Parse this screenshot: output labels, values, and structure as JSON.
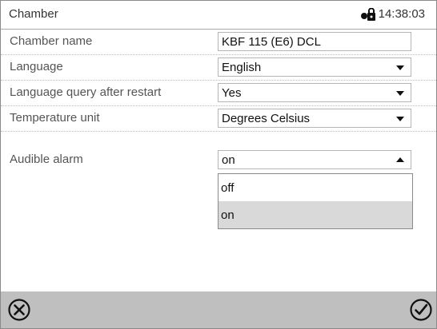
{
  "header": {
    "title": "Chamber",
    "time": "14:38:03",
    "lock_icon": "lock-icon"
  },
  "settings": {
    "chamber_name": {
      "label": "Chamber name",
      "value": "KBF 115 (E6) DCL"
    },
    "language": {
      "label": "Language",
      "value": "English"
    },
    "language_query": {
      "label": "Language query after restart",
      "value": "Yes"
    },
    "temperature_unit": {
      "label": "Temperature unit",
      "value": "Degrees Celsius"
    },
    "audible_alarm": {
      "label": "Audible alarm",
      "value": "on"
    }
  },
  "dropdown": {
    "options": [
      {
        "label": "off"
      },
      {
        "label": "on"
      }
    ],
    "selected": "on"
  },
  "footer": {
    "cancel_icon": "cancel-icon",
    "confirm_icon": "confirm-check-icon"
  },
  "colors": {
    "footer_bg": "#bfbfbf",
    "selected_option_bg": "#d9d9d9"
  }
}
